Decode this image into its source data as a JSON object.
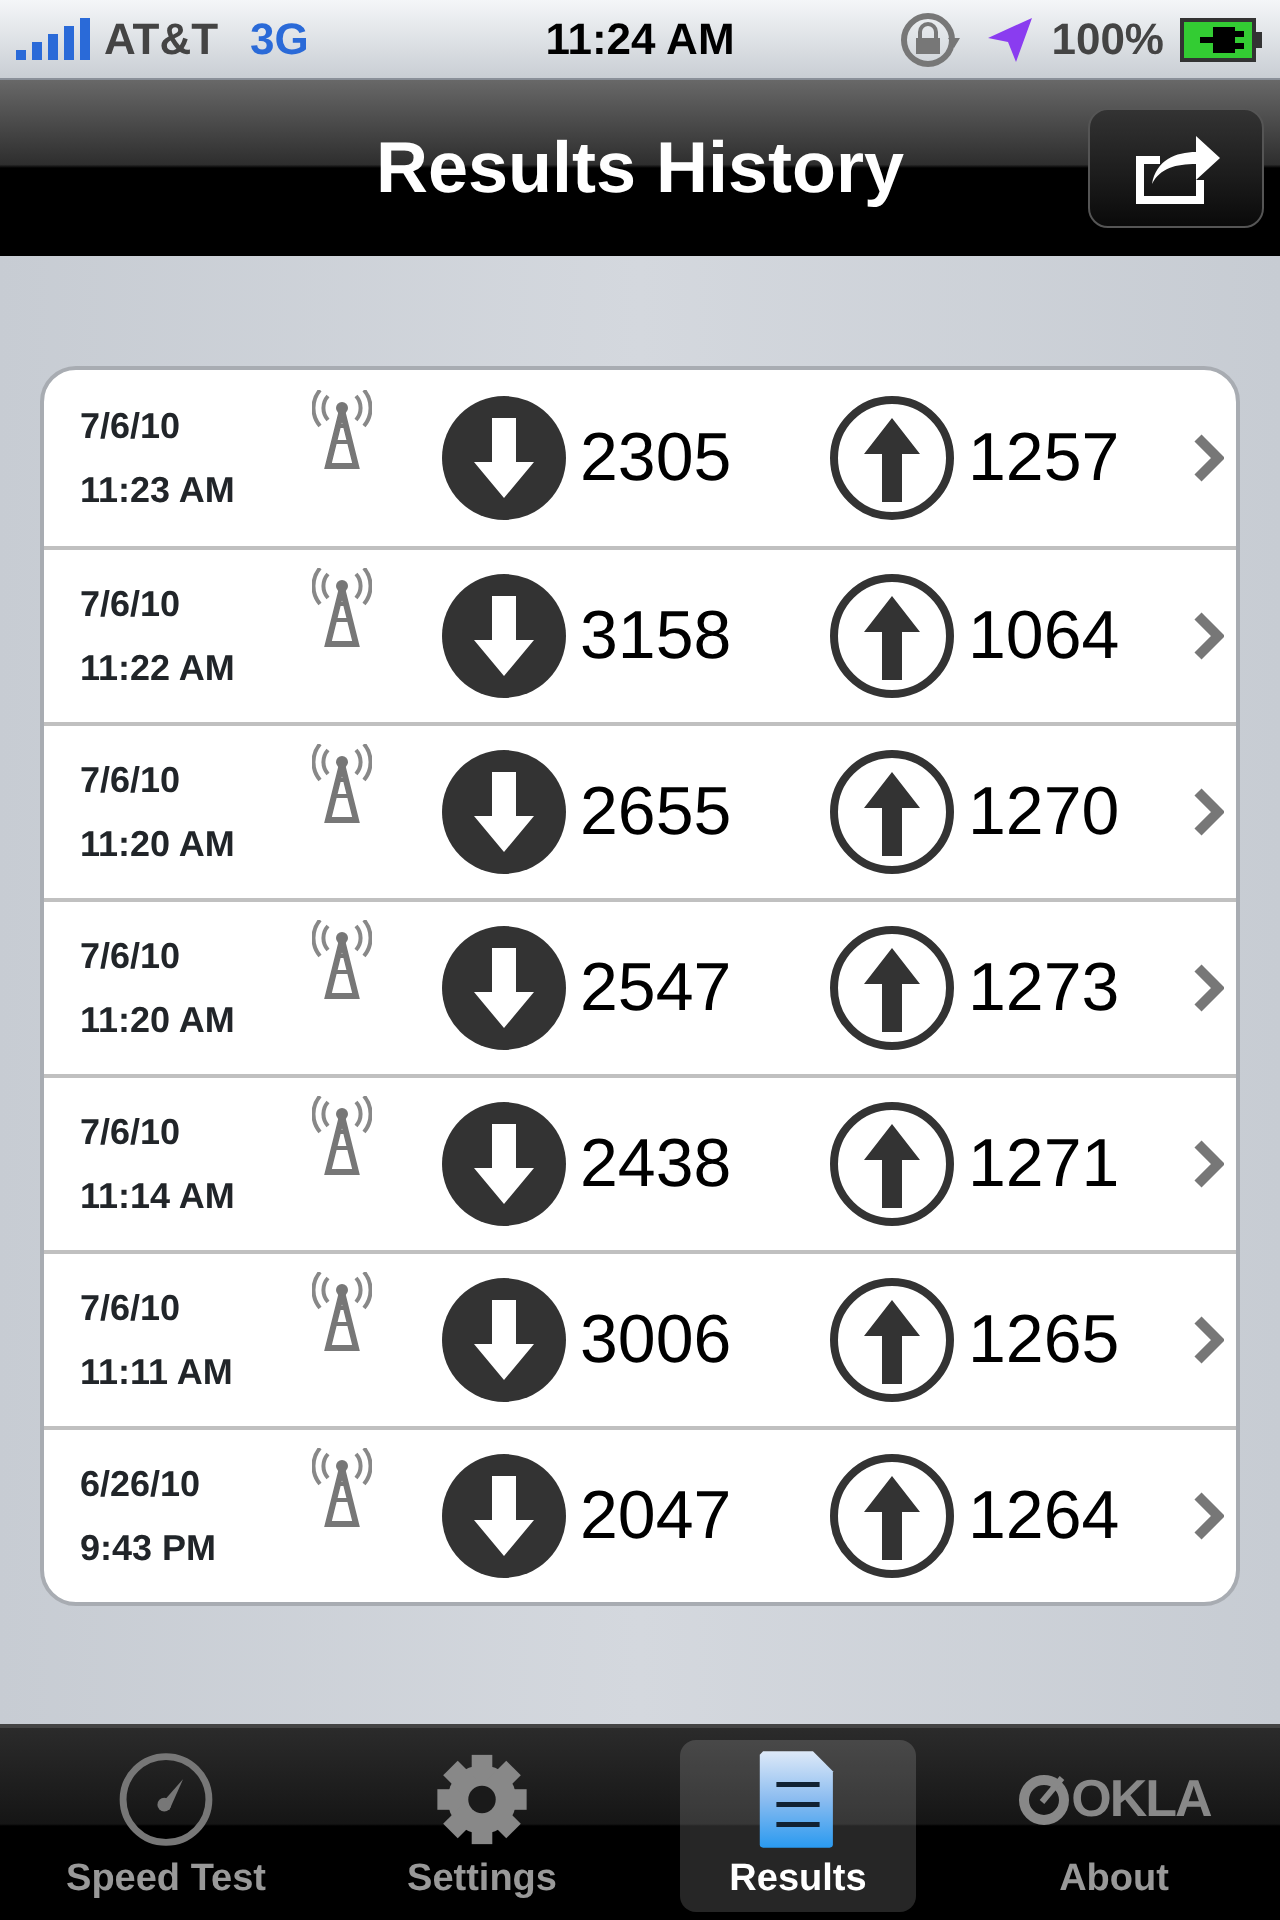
{
  "status_bar": {
    "carrier": "AT&T",
    "network": "3G",
    "time": "11:24 AM",
    "battery": "100%"
  },
  "nav_bar": {
    "title": "Results History"
  },
  "results": [
    {
      "date": "7/6/10",
      "time": "11:23 AM",
      "download": "2305",
      "upload": "1257"
    },
    {
      "date": "7/6/10",
      "time": "11:22 AM",
      "download": "3158",
      "upload": "1064"
    },
    {
      "date": "7/6/10",
      "time": "11:20 AM",
      "download": "2655",
      "upload": "1270"
    },
    {
      "date": "7/6/10",
      "time": "11:20 AM",
      "download": "2547",
      "upload": "1273"
    },
    {
      "date": "7/6/10",
      "time": "11:14 AM",
      "download": "2438",
      "upload": "1271"
    },
    {
      "date": "7/6/10",
      "time": "11:11 AM",
      "download": "3006",
      "upload": "1265"
    },
    {
      "date": "6/26/10",
      "time": "9:43 PM",
      "download": "2047",
      "upload": "1264"
    }
  ],
  "tab_bar": [
    {
      "kind": "gauge",
      "label": "Speed Test",
      "selected": false
    },
    {
      "kind": "gear",
      "label": "Settings",
      "selected": false
    },
    {
      "kind": "document",
      "label": "Results",
      "selected": true
    },
    {
      "kind": "logo",
      "label": "About",
      "logo_text": "OKLA",
      "selected": false
    }
  ]
}
